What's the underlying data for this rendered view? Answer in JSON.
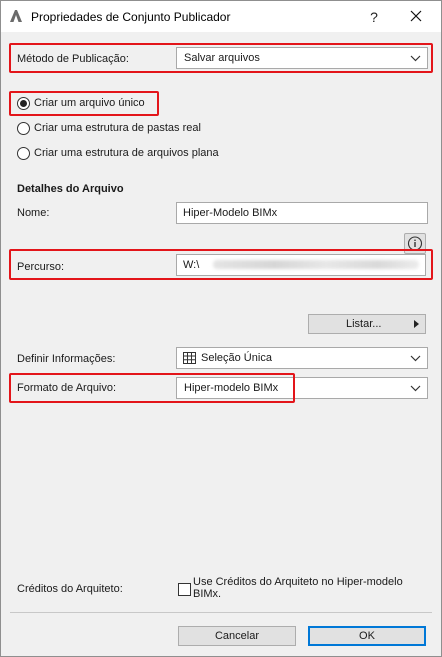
{
  "window": {
    "title": "Propriedades de Conjunto Publicador",
    "help_label": "?"
  },
  "publish_method": {
    "label": "Método de Publicação:",
    "value": "Salvar arquivos"
  },
  "structure_options": [
    {
      "label": "Criar um arquivo único",
      "checked": true
    },
    {
      "label": "Criar uma estrutura de pastas real",
      "checked": false
    },
    {
      "label": "Criar uma estrutura de arquivos plana",
      "checked": false
    }
  ],
  "file_details": {
    "heading": "Detalhes do Arquivo",
    "name_label": "Nome:",
    "name_value": "Hiper-Modelo BIMx",
    "path_label": "Percurso:",
    "path_value": "W:\\",
    "browse_label": "Listar..."
  },
  "define_info": {
    "label": "Definir Informações:",
    "value": "Seleção Única"
  },
  "file_format": {
    "label": "Formato de Arquivo:",
    "value": "Hiper-modelo BIMx"
  },
  "architect_credits": {
    "label": "Créditos do Arquiteto:",
    "checkbox_label": "Use Créditos do Arquiteto no Hiper-modelo BIMx.",
    "checked": false
  },
  "footer": {
    "cancel_label": "Cancelar",
    "ok_label": "OK"
  },
  "colors": {
    "highlight": "#e3151a",
    "default_button_border": "#0078d7",
    "dialog_background": "#f0f0f0"
  }
}
